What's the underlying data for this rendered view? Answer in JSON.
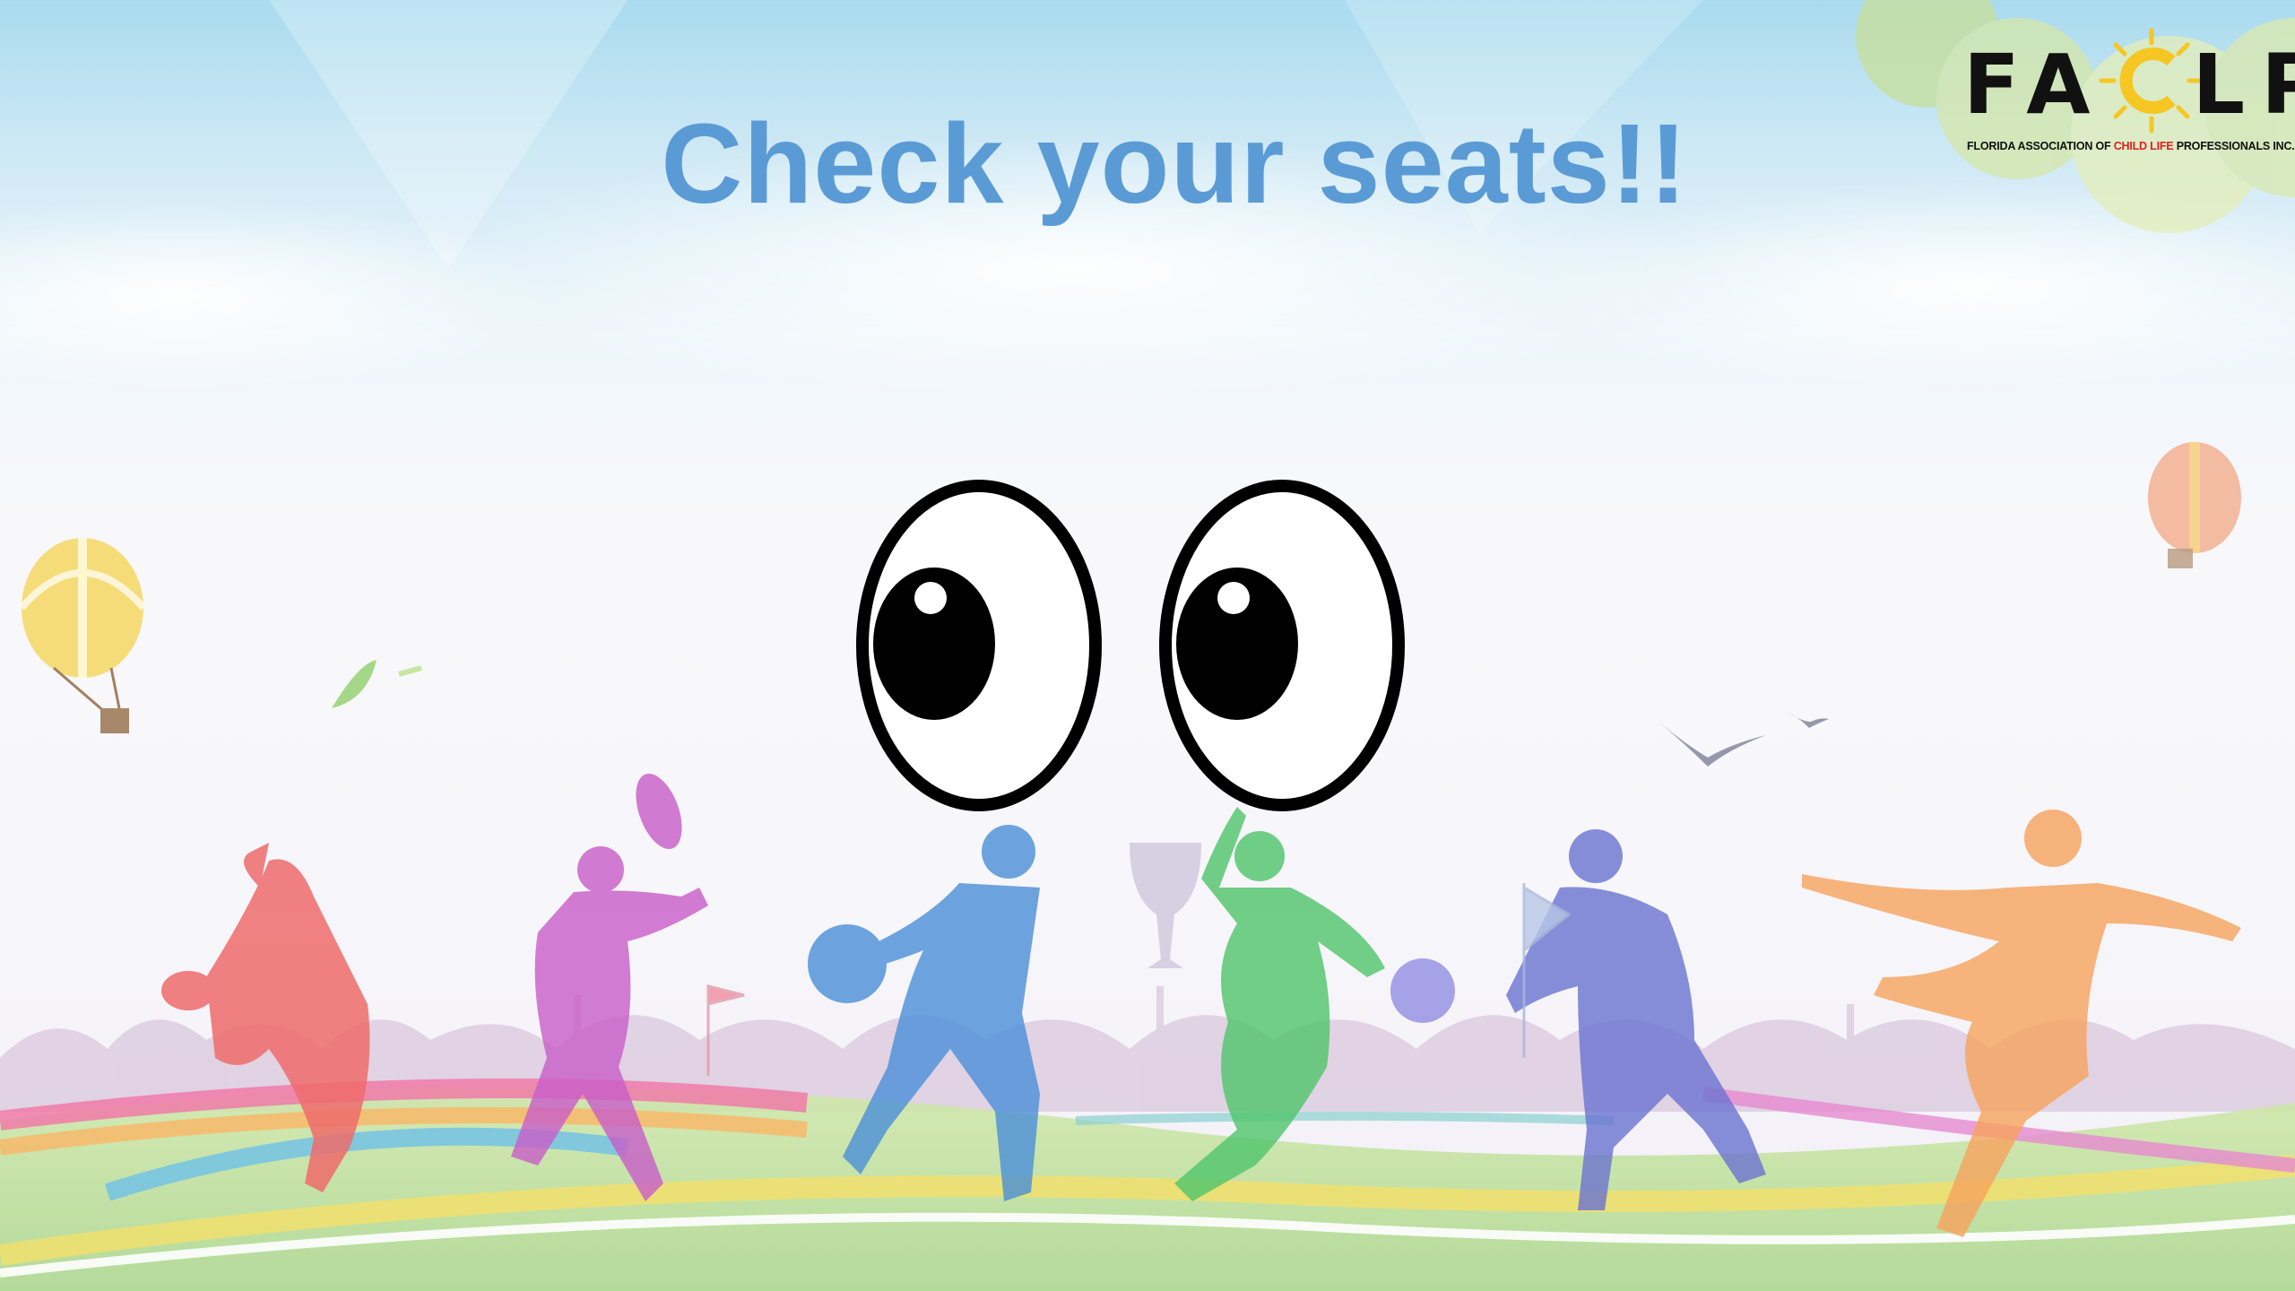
{
  "slide": {
    "title": "Check your seats!!",
    "title_color": "#5b9bd5"
  },
  "logo": {
    "mark_letters": "FACLP",
    "tagline_pre": "FLORIDA ASSOCIATION OF ",
    "tagline_highlight": "CHILD LIFE",
    "tagline_post": " PROFESSIONALS  INC.",
    "highlight_color": "#e02020",
    "sun_color": "#f6c623"
  },
  "illustration": {
    "eyes_icon": "googly-eyes-icon",
    "background": "sports-silhouettes-crowd-rainbow-track",
    "balloon_colors": [
      "#f4d86a",
      "#f1a17c"
    ],
    "athlete_colors": [
      "#ee6b6b",
      "#c85cc8",
      "#4a8fd8",
      "#4fc46a",
      "#6a73d0",
      "#f6a25c"
    ]
  }
}
